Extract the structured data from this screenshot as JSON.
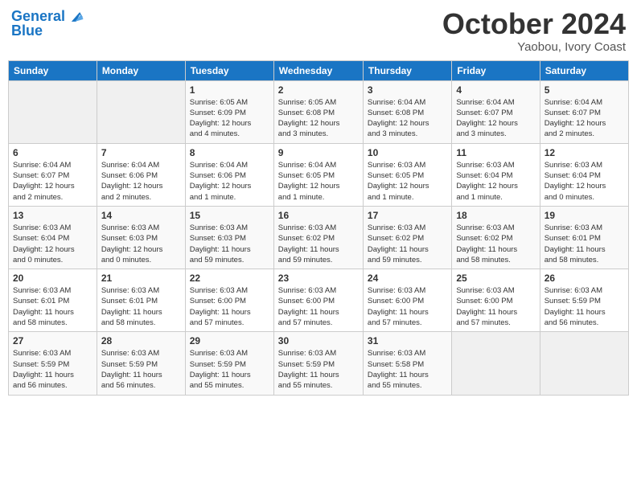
{
  "logo": {
    "line1": "General",
    "line2": "Blue"
  },
  "title": "October 2024",
  "subtitle": "Yaobou, Ivory Coast",
  "days_of_week": [
    "Sunday",
    "Monday",
    "Tuesday",
    "Wednesday",
    "Thursday",
    "Friday",
    "Saturday"
  ],
  "weeks": [
    [
      {
        "day": "",
        "info": ""
      },
      {
        "day": "",
        "info": ""
      },
      {
        "day": "1",
        "info": "Sunrise: 6:05 AM\nSunset: 6:09 PM\nDaylight: 12 hours\nand 4 minutes."
      },
      {
        "day": "2",
        "info": "Sunrise: 6:05 AM\nSunset: 6:08 PM\nDaylight: 12 hours\nand 3 minutes."
      },
      {
        "day": "3",
        "info": "Sunrise: 6:04 AM\nSunset: 6:08 PM\nDaylight: 12 hours\nand 3 minutes."
      },
      {
        "day": "4",
        "info": "Sunrise: 6:04 AM\nSunset: 6:07 PM\nDaylight: 12 hours\nand 3 minutes."
      },
      {
        "day": "5",
        "info": "Sunrise: 6:04 AM\nSunset: 6:07 PM\nDaylight: 12 hours\nand 2 minutes."
      }
    ],
    [
      {
        "day": "6",
        "info": "Sunrise: 6:04 AM\nSunset: 6:07 PM\nDaylight: 12 hours\nand 2 minutes."
      },
      {
        "day": "7",
        "info": "Sunrise: 6:04 AM\nSunset: 6:06 PM\nDaylight: 12 hours\nand 2 minutes."
      },
      {
        "day": "8",
        "info": "Sunrise: 6:04 AM\nSunset: 6:06 PM\nDaylight: 12 hours\nand 1 minute."
      },
      {
        "day": "9",
        "info": "Sunrise: 6:04 AM\nSunset: 6:05 PM\nDaylight: 12 hours\nand 1 minute."
      },
      {
        "day": "10",
        "info": "Sunrise: 6:03 AM\nSunset: 6:05 PM\nDaylight: 12 hours\nand 1 minute."
      },
      {
        "day": "11",
        "info": "Sunrise: 6:03 AM\nSunset: 6:04 PM\nDaylight: 12 hours\nand 1 minute."
      },
      {
        "day": "12",
        "info": "Sunrise: 6:03 AM\nSunset: 6:04 PM\nDaylight: 12 hours\nand 0 minutes."
      }
    ],
    [
      {
        "day": "13",
        "info": "Sunrise: 6:03 AM\nSunset: 6:04 PM\nDaylight: 12 hours\nand 0 minutes."
      },
      {
        "day": "14",
        "info": "Sunrise: 6:03 AM\nSunset: 6:03 PM\nDaylight: 12 hours\nand 0 minutes."
      },
      {
        "day": "15",
        "info": "Sunrise: 6:03 AM\nSunset: 6:03 PM\nDaylight: 11 hours\nand 59 minutes."
      },
      {
        "day": "16",
        "info": "Sunrise: 6:03 AM\nSunset: 6:02 PM\nDaylight: 11 hours\nand 59 minutes."
      },
      {
        "day": "17",
        "info": "Sunrise: 6:03 AM\nSunset: 6:02 PM\nDaylight: 11 hours\nand 59 minutes."
      },
      {
        "day": "18",
        "info": "Sunrise: 6:03 AM\nSunset: 6:02 PM\nDaylight: 11 hours\nand 58 minutes."
      },
      {
        "day": "19",
        "info": "Sunrise: 6:03 AM\nSunset: 6:01 PM\nDaylight: 11 hours\nand 58 minutes."
      }
    ],
    [
      {
        "day": "20",
        "info": "Sunrise: 6:03 AM\nSunset: 6:01 PM\nDaylight: 11 hours\nand 58 minutes."
      },
      {
        "day": "21",
        "info": "Sunrise: 6:03 AM\nSunset: 6:01 PM\nDaylight: 11 hours\nand 58 minutes."
      },
      {
        "day": "22",
        "info": "Sunrise: 6:03 AM\nSunset: 6:00 PM\nDaylight: 11 hours\nand 57 minutes."
      },
      {
        "day": "23",
        "info": "Sunrise: 6:03 AM\nSunset: 6:00 PM\nDaylight: 11 hours\nand 57 minutes."
      },
      {
        "day": "24",
        "info": "Sunrise: 6:03 AM\nSunset: 6:00 PM\nDaylight: 11 hours\nand 57 minutes."
      },
      {
        "day": "25",
        "info": "Sunrise: 6:03 AM\nSunset: 6:00 PM\nDaylight: 11 hours\nand 57 minutes."
      },
      {
        "day": "26",
        "info": "Sunrise: 6:03 AM\nSunset: 5:59 PM\nDaylight: 11 hours\nand 56 minutes."
      }
    ],
    [
      {
        "day": "27",
        "info": "Sunrise: 6:03 AM\nSunset: 5:59 PM\nDaylight: 11 hours\nand 56 minutes."
      },
      {
        "day": "28",
        "info": "Sunrise: 6:03 AM\nSunset: 5:59 PM\nDaylight: 11 hours\nand 56 minutes."
      },
      {
        "day": "29",
        "info": "Sunrise: 6:03 AM\nSunset: 5:59 PM\nDaylight: 11 hours\nand 55 minutes."
      },
      {
        "day": "30",
        "info": "Sunrise: 6:03 AM\nSunset: 5:59 PM\nDaylight: 11 hours\nand 55 minutes."
      },
      {
        "day": "31",
        "info": "Sunrise: 6:03 AM\nSunset: 5:58 PM\nDaylight: 11 hours\nand 55 minutes."
      },
      {
        "day": "",
        "info": ""
      },
      {
        "day": "",
        "info": ""
      }
    ]
  ]
}
